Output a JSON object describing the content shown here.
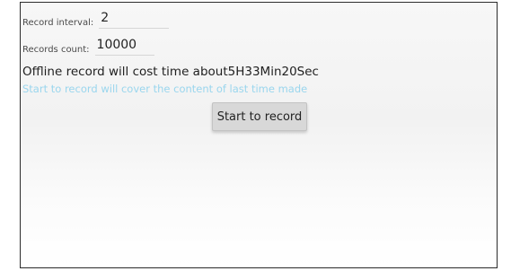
{
  "form": {
    "interval_label": "Record interval:",
    "interval_value": "2",
    "count_label": "Records count:",
    "count_value": "10000"
  },
  "info_text": "Offline record will cost time about5H33Min20Sec",
  "warning_text": "Start to record will cover the content of last time made",
  "buttons": {
    "start_label": "Start to record"
  },
  "colors": {
    "warning_text": "#9ad6ee",
    "button_bg": "#d8d8d8",
    "frame_border": "#2b2b2b"
  }
}
